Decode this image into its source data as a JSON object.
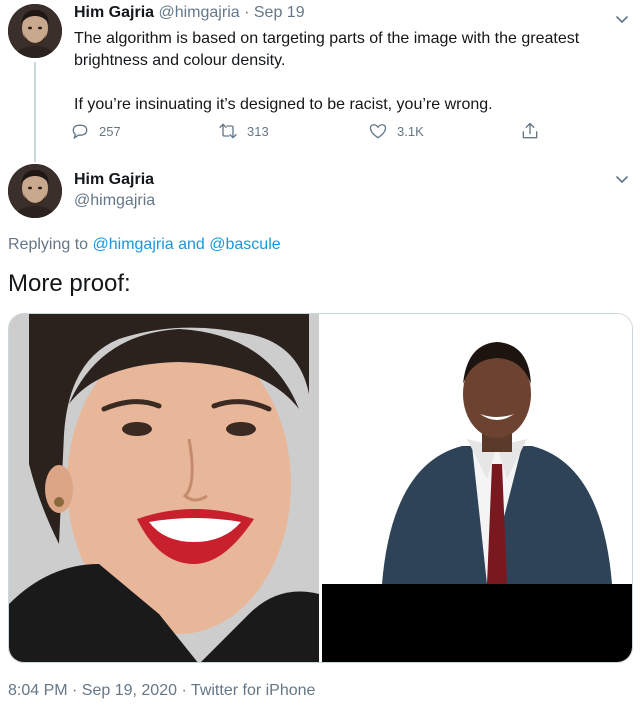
{
  "tweet1": {
    "name": "Him Gajria",
    "handle": "@himgajria",
    "separator": "·",
    "date": "Sep 19",
    "text_line1": "The algorithm is based on targeting parts of the image with the greatest brightness and colour density.",
    "text_line2": "If you’re insinuating it’s designed to be racist, you’re wrong.",
    "actions": {
      "replies": "257",
      "retweets": "313",
      "likes": "3.1K"
    }
  },
  "tweet2": {
    "name": "Him Gajria",
    "handle": "@himgajria",
    "replying_prefix": "Replying to",
    "replying_user1": "@himgajria",
    "replying_and": "and",
    "replying_user2": "@bascule",
    "text": "More proof:",
    "footer": "8:04 PM · Sep 19, 2020 · Twitter for iPhone"
  },
  "colors": {
    "text": "#14171a",
    "secondary": "#657786",
    "link": "#1b95e0",
    "border": "#ccd6dd"
  },
  "icons": [
    "reply-icon",
    "retweet-icon",
    "like-icon",
    "share-icon",
    "chevron-down-icon"
  ]
}
